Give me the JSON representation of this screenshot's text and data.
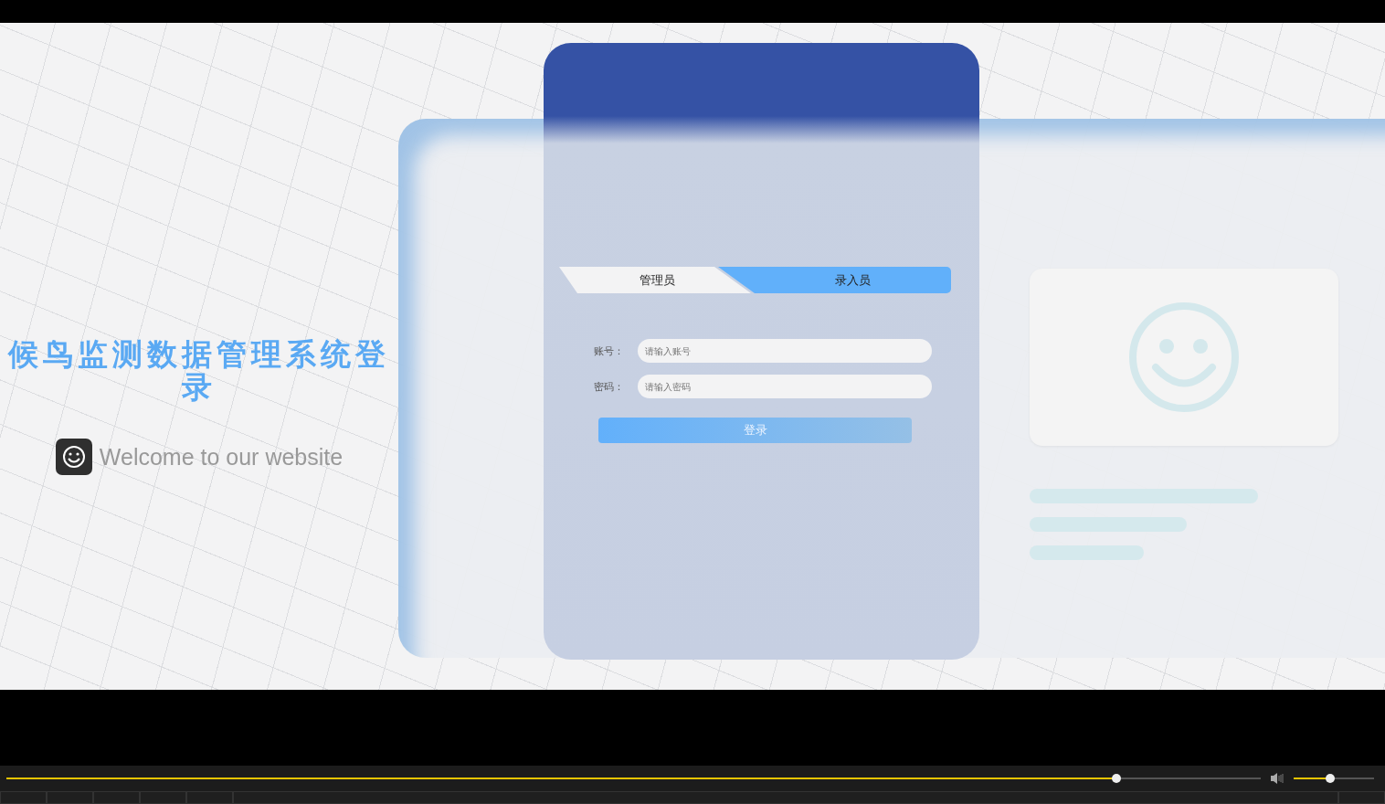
{
  "page": {
    "title": "候鸟监测数据管理系统登录",
    "welcome": "Welcome to our website"
  },
  "login": {
    "tabs": [
      {
        "label": "管理员",
        "selected": true
      },
      {
        "label": "录入员",
        "selected": false
      }
    ],
    "fields": [
      {
        "label": "账号：",
        "placeholder": "请输入账号"
      },
      {
        "label": "密码：",
        "placeholder": "请输入密码"
      }
    ],
    "button": "登录"
  },
  "player": {
    "progress": {
      "level": 0.885
    },
    "volume": {
      "level": 0.45
    }
  }
}
